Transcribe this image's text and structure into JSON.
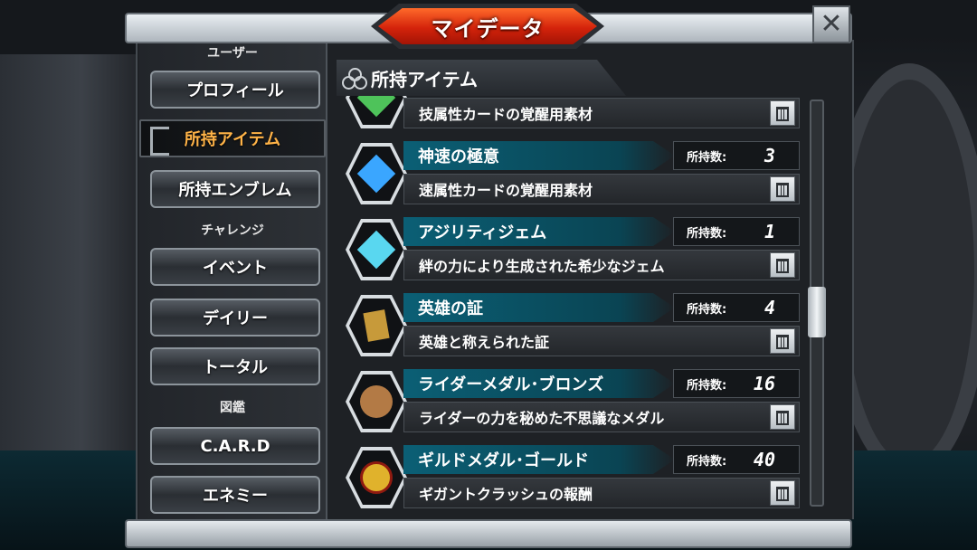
{
  "window": {
    "title": "マイデータ",
    "close_icon": "close-x-icon"
  },
  "sidebar": {
    "sections": [
      {
        "label": "ユーザー",
        "items": [
          "プロフィール",
          "所持アイテム",
          "所持エンブレム"
        ]
      },
      {
        "label": "チャレンジ",
        "items": [
          "イベント",
          "デイリー",
          "トータル"
        ]
      },
      {
        "label": "図鑑",
        "items": [
          "C.A.R.D",
          "エネミー"
        ]
      }
    ],
    "active_item": "所持アイテム"
  },
  "content": {
    "title": "所持アイテム",
    "qty_label": "所持数:",
    "partial_item": {
      "desc": "技属性カードの覚醒用素材",
      "gem_color": "#4ec35a"
    },
    "items": [
      {
        "name": "神速の極意",
        "qty": "3",
        "desc": "速属性カードの覚醒用素材",
        "icon": "blue-crystal-icon",
        "gem_color": "#3aa6ff"
      },
      {
        "name": "アジリティジェム",
        "qty": "1",
        "desc": "絆の力により生成された希少なジェム",
        "icon": "cyan-gem-icon",
        "gem_color": "#59d7f0"
      },
      {
        "name": "英雄の証",
        "qty": "4",
        "desc": "英雄と称えられた証",
        "icon": "hero-card-icon",
        "gem_color": "#c79a3a"
      },
      {
        "name": "ライダーメダル･ブロンズ",
        "qty": "16",
        "desc": "ライダーの力を秘めた不思議なメダル",
        "icon": "bronze-medal-icon",
        "gem_color": "#b37a45"
      },
      {
        "name": "ギルドメダル･ゴールド",
        "qty": "40",
        "desc": "ギガントクラッシュの報酬",
        "icon": "gold-medal-icon",
        "gem_color": "#e0b22c"
      }
    ]
  },
  "scroll_position": 0.45
}
